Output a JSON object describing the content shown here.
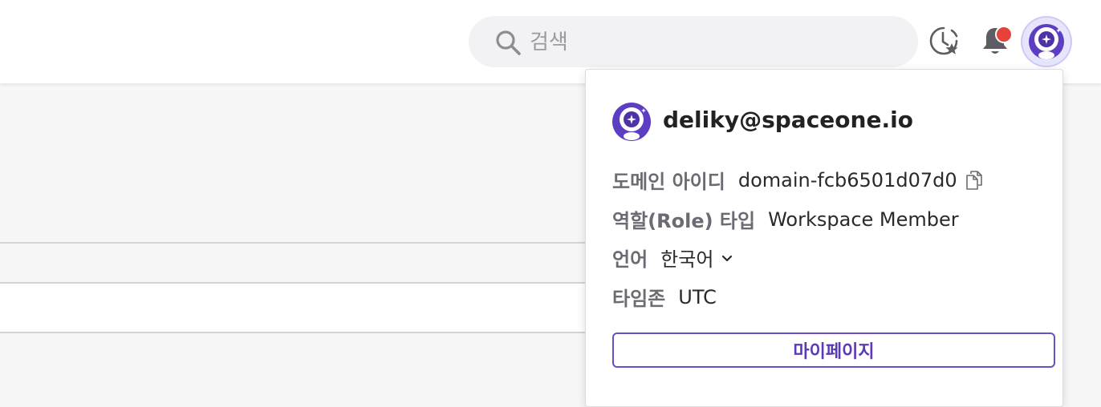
{
  "header": {
    "search": {
      "placeholder": "검색"
    },
    "icons": {
      "recent": "recent-favorite-icon",
      "notifications": "bell-icon",
      "profile": "profile-avatar-icon"
    },
    "has_unread_notifications": true
  },
  "profile_menu": {
    "email": "deliky@spaceone.io",
    "domain_id": {
      "label": "도메인 아이디",
      "value": "domain-fcb6501d07d0"
    },
    "role_type": {
      "label": "역할(Role) 타입",
      "value": "Workspace Member"
    },
    "language": {
      "label": "언어",
      "value": "한국어"
    },
    "timezone": {
      "label": "타임존",
      "value": "UTC"
    },
    "mypage_button": "마이페이지"
  },
  "colors": {
    "accent": "#6a4fc8",
    "notification_dot": "#e5433a",
    "label_gray": "#6b6b73"
  }
}
